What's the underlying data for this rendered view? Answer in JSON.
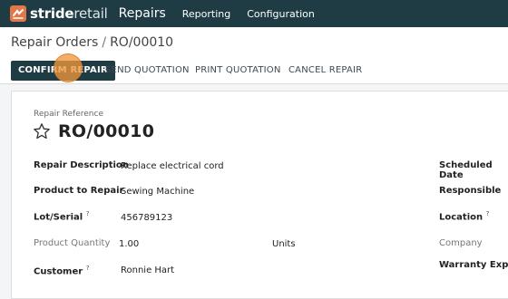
{
  "navbar": {
    "brand_bold": "stride",
    "brand_light": "retail",
    "app_name": "Repairs",
    "menus": [
      "Reporting",
      "Configuration"
    ],
    "brand_icon": "stride-logo-icon"
  },
  "breadcrumb": {
    "parent": "Repair Orders",
    "separator": "/",
    "current": "RO/00010"
  },
  "actions": {
    "confirm": "CONFIRM REPAIR",
    "send": "SEND QUOTATION",
    "print": "PRINT QUOTATION",
    "cancel": "CANCEL REPAIR"
  },
  "form": {
    "reference_label": "Repair Reference",
    "reference": "RO/00010",
    "star_icon": "star-icon",
    "left_fields": {
      "description": {
        "label": "Repair Description",
        "value": "Replace electrical cord"
      },
      "product": {
        "label": "Product to Repair",
        "value": "Sewing Machine"
      },
      "lot": {
        "label": "Lot/Serial",
        "help": "?",
        "value": "456789123"
      },
      "quantity": {
        "label": "Product Quantity",
        "value": "1.00",
        "unit": "Units"
      },
      "customer": {
        "label": "Customer",
        "help": "?",
        "value": "Ronnie Hart"
      }
    },
    "right_fields": {
      "scheduled": {
        "label": "Scheduled Date"
      },
      "responsible": {
        "label": "Responsible"
      },
      "location": {
        "label": "Location",
        "help": "?"
      },
      "company": {
        "label": "Company"
      },
      "warranty": {
        "label": "Warranty Expirati"
      }
    }
  },
  "colors": {
    "navbar": "#1f3c45",
    "primary_button": "#1f3c45",
    "click_indicator": "#f0963c"
  }
}
